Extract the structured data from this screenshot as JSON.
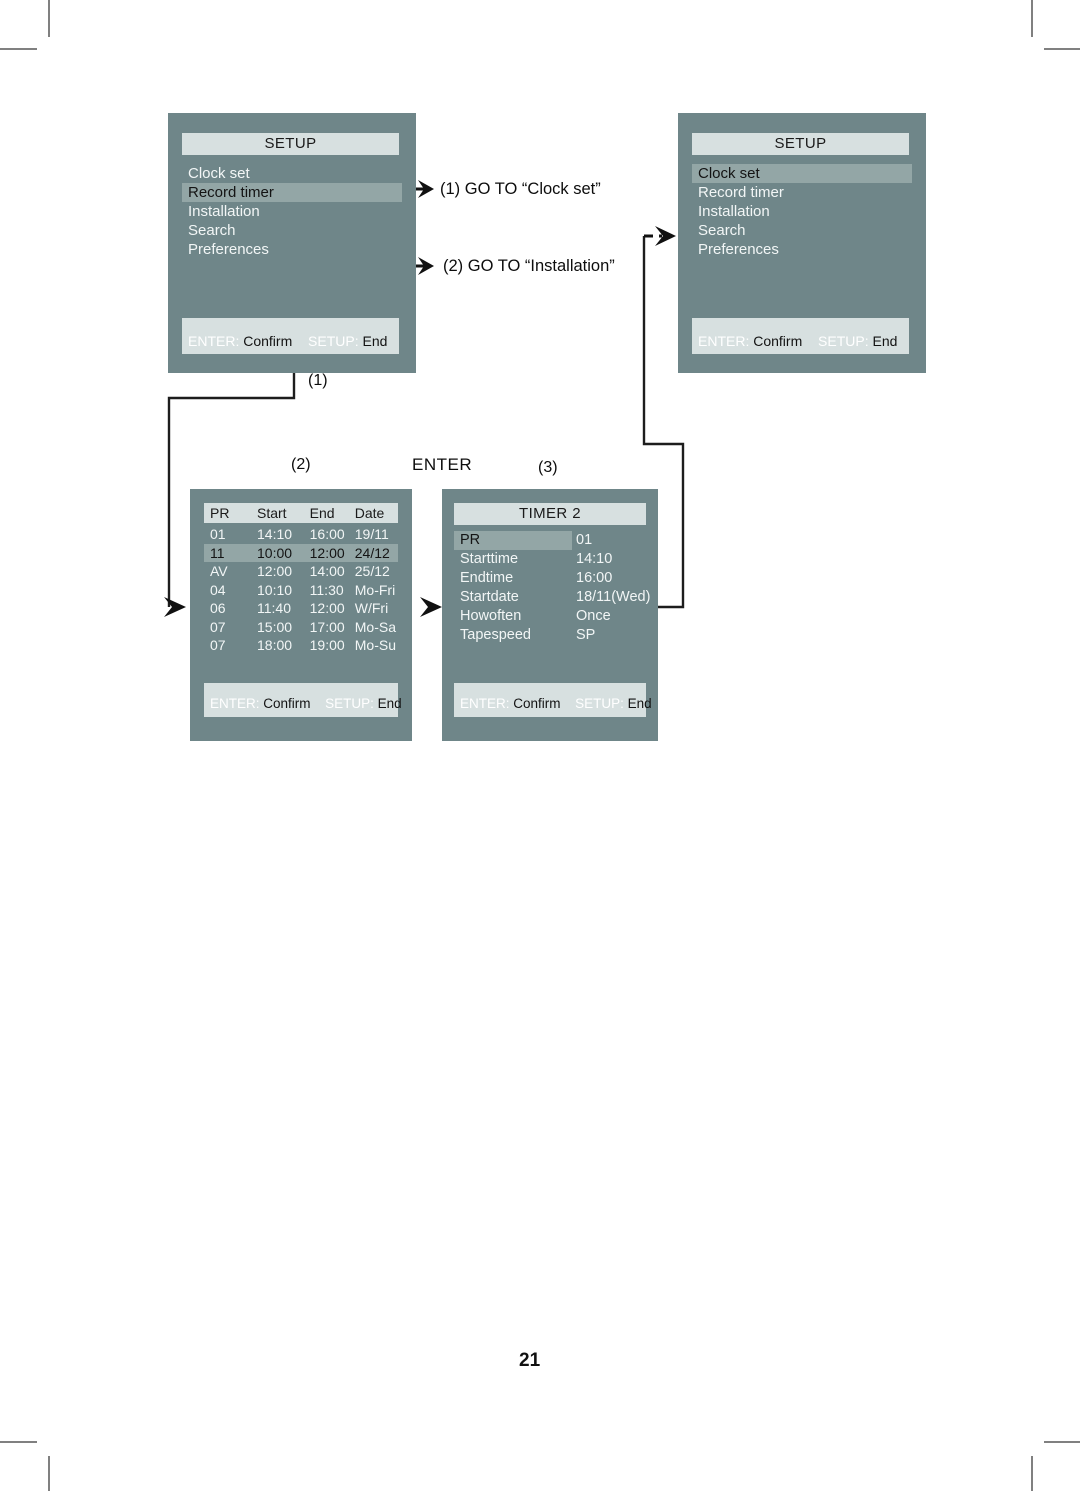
{
  "page": {
    "number": "21"
  },
  "setup_left": {
    "title": "SETUP",
    "items": [
      {
        "label": "Clock set",
        "selected": false
      },
      {
        "label": "Record timer",
        "selected": true
      },
      {
        "label": "Installation",
        "selected": false
      },
      {
        "label": "Search",
        "selected": false
      },
      {
        "label": "Preferences",
        "selected": false
      }
    ],
    "footer": {
      "enter_key": "ENTER:",
      "enter_action": "Confirm",
      "setup_key": "SETUP:",
      "setup_action": "End"
    }
  },
  "setup_right": {
    "title": "SETUP",
    "items": [
      {
        "label": "Clock set",
        "selected": true
      },
      {
        "label": "Record timer",
        "selected": false
      },
      {
        "label": "Installation",
        "selected": false
      },
      {
        "label": "Search",
        "selected": false
      },
      {
        "label": "Preferences",
        "selected": false
      }
    ],
    "footer": {
      "enter_key": "ENTER:",
      "enter_action": "Confirm",
      "setup_key": "SETUP:",
      "setup_action": "End"
    }
  },
  "timer_list": {
    "columns": [
      "PR",
      "Start",
      "End",
      "Date"
    ],
    "rows": [
      {
        "pr": "01",
        "start": "14:10",
        "end": "16:00",
        "date": "19/11",
        "selected": false
      },
      {
        "pr": "11",
        "start": "10:00",
        "end": "12:00",
        "date": "24/12",
        "selected": true
      },
      {
        "pr": "AV",
        "start": "12:00",
        "end": "14:00",
        "date": "25/12",
        "selected": false
      },
      {
        "pr": "04",
        "start": "10:10",
        "end": "11:30",
        "date": "Mo-Fri",
        "selected": false
      },
      {
        "pr": "06",
        "start": "11:40",
        "end": "12:00",
        "date": "W/Fri",
        "selected": false
      },
      {
        "pr": "07",
        "start": "15:00",
        "end": "17:00",
        "date": "Mo-Sa",
        "selected": false
      },
      {
        "pr": "07",
        "start": "18:00",
        "end": "19:00",
        "date": "Mo-Su",
        "selected": false
      }
    ],
    "footer": {
      "enter_key": "ENTER:",
      "enter_action": "Confirm",
      "setup_key": "SETUP:",
      "setup_action": "End"
    }
  },
  "timer_detail": {
    "title": "TIMER 2",
    "fields": [
      {
        "key": "PR",
        "value": "01",
        "selected": true
      },
      {
        "key": "Starttime",
        "value": "14:10",
        "selected": false
      },
      {
        "key": "Endtime",
        "value": "16:00",
        "selected": false
      },
      {
        "key": "Startdate",
        "value": "18/11(Wed)",
        "selected": false
      },
      {
        "key": "Howoften",
        "value": "Once",
        "selected": false
      },
      {
        "key": "Tapespeed",
        "value": "SP",
        "selected": false
      }
    ],
    "footer": {
      "enter_key": "ENTER:",
      "enter_action": "Confirm",
      "setup_key": "SETUP:",
      "setup_action": "End"
    }
  },
  "callouts": {
    "go_to_clock_set": "(1) GO TO “Clock set”",
    "go_to_installation": "(2) GO TO “Installation”",
    "enter": "ENTER",
    "marker_1": "(1)",
    "marker_2": "(2)",
    "marker_3": "(3)"
  },
  "colors": {
    "panel_bg": "#6f8689",
    "panel_header": "#d7e0e0",
    "row_selected": "#93a6a6",
    "text_light": "#f2f6f6",
    "text_dark": "#141414"
  }
}
